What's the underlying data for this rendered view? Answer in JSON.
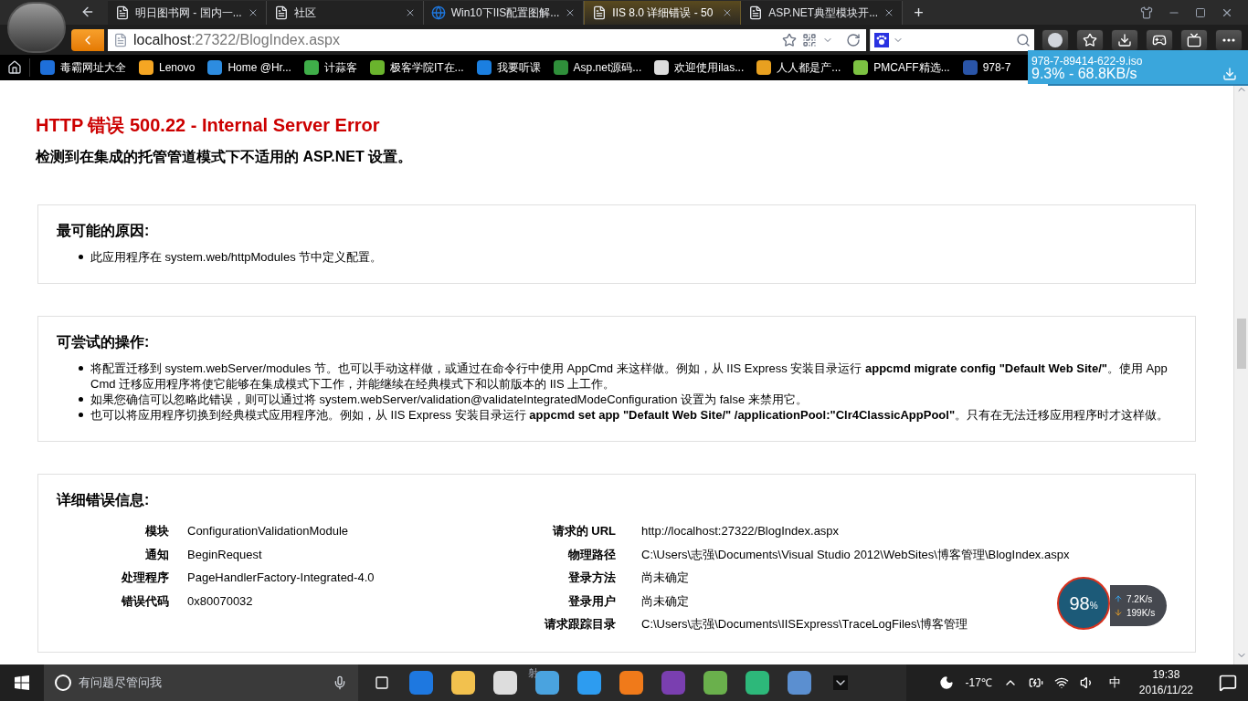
{
  "browser": {
    "tabs": [
      {
        "title": "明日图书网 - 国内一...",
        "selected": false
      },
      {
        "title": "社区",
        "selected": false
      },
      {
        "title": "Win10下IIS配置图解...",
        "selected": false
      },
      {
        "title": "IIS 8.0 详细错误 - 50",
        "selected": true
      },
      {
        "title": "ASP.NET典型模块开...",
        "selected": false
      }
    ],
    "new_tab": "+",
    "address": {
      "host": "localhost",
      "path": ":27322/BlogIndex.aspx"
    },
    "bookmarks": [
      {
        "label": "毒霸网址大全",
        "color": "#1e6fd9"
      },
      {
        "label": "Lenovo",
        "color": "#f5a623"
      },
      {
        "label": "Home @Hr...",
        "color": "#2d8ce0"
      },
      {
        "label": "计蒜客",
        "color": "#3fae49"
      },
      {
        "label": "极客学院IT在...",
        "color": "#6ab42d"
      },
      {
        "label": "我要听课",
        "color": "#1b7fe0"
      },
      {
        "label": "Asp.net源码...",
        "color": "#2f8f3a"
      },
      {
        "label": "欢迎使用ilas...",
        "color": "#dddddd"
      },
      {
        "label": "人人都是产...",
        "color": "#e8a020"
      },
      {
        "label": "PMCAFF精选...",
        "color": "#7cc242"
      },
      {
        "label": "978-7",
        "color": "#2a55a8"
      }
    ],
    "download": {
      "file": "978-7-89414-622-9.iso",
      "progress": "9.3% - 68.8KB/s",
      "level": 0.093
    }
  },
  "page": {
    "title": "HTTP 错误 500.22 - Internal Server Error",
    "subtitle": "检测到在集成的托管管道模式下不适用的 ASP.NET 设置。",
    "sections": [
      {
        "heading": "最可能的原因:",
        "items": [
          "此应用程序在 system.web/httpModules 节中定义配置。"
        ]
      },
      {
        "heading": "可尝试的操作:",
        "items": [
          "将配置迁移到 system.webServer/modules 节。也可以手动这样做，或通过在命令行中使用 AppCmd 来这样做。例如，从 IIS Express 安装目录运行 **appcmd migrate config \"Default Web Site/\"**。使用 AppCmd 迁移应用程序将使它能够在集成模式下工作，并能继续在经典模式下和以前版本的 IIS 上工作。",
          "如果您确信可以忽略此错误，则可以通过将 system.webServer/validation@validateIntegratedModeConfiguration 设置为 false 来禁用它。",
          "也可以将应用程序切换到经典模式应用程序池。例如，从 IIS Express 安装目录运行 **appcmd set app \"Default Web Site/\" /applicationPool:\"Clr4ClassicAppPool\"**。只有在无法迁移应用程序时才这样做。"
        ]
      }
    ],
    "details": {
      "heading": "详细错误信息:",
      "left": [
        {
          "label": "模块",
          "value": "ConfigurationValidationModule"
        },
        {
          "label": "通知",
          "value": "BeginRequest"
        },
        {
          "label": "处理程序",
          "value": "PageHandlerFactory-Integrated-4.0"
        },
        {
          "label": "错误代码",
          "value": "0x80070032"
        }
      ],
      "right": [
        {
          "label": "请求的 URL",
          "value": "http://localhost:27322/BlogIndex.aspx"
        },
        {
          "label": "物理路径",
          "value": "C:\\Users\\志强\\Documents\\Visual Studio 2012\\WebSites\\博客管理\\BlogIndex.aspx"
        },
        {
          "label": "登录方法",
          "value": "尚未确定"
        },
        {
          "label": "登录用户",
          "value": "尚未确定"
        },
        {
          "label": "请求跟踪目录",
          "value": "C:\\Users\\志强\\Documents\\IISExpress\\TraceLogFiles\\博客管理"
        }
      ]
    }
  },
  "net_widget": {
    "percent": "98",
    "unit": "%",
    "upload": "7.2K/s",
    "download": "199K/s"
  },
  "taskbar": {
    "search_placeholder": "有问题尽管问我",
    "fragment": "射",
    "weather": "-17℃",
    "ime": "中",
    "time": "19:38",
    "date": "2016/11/22"
  }
}
